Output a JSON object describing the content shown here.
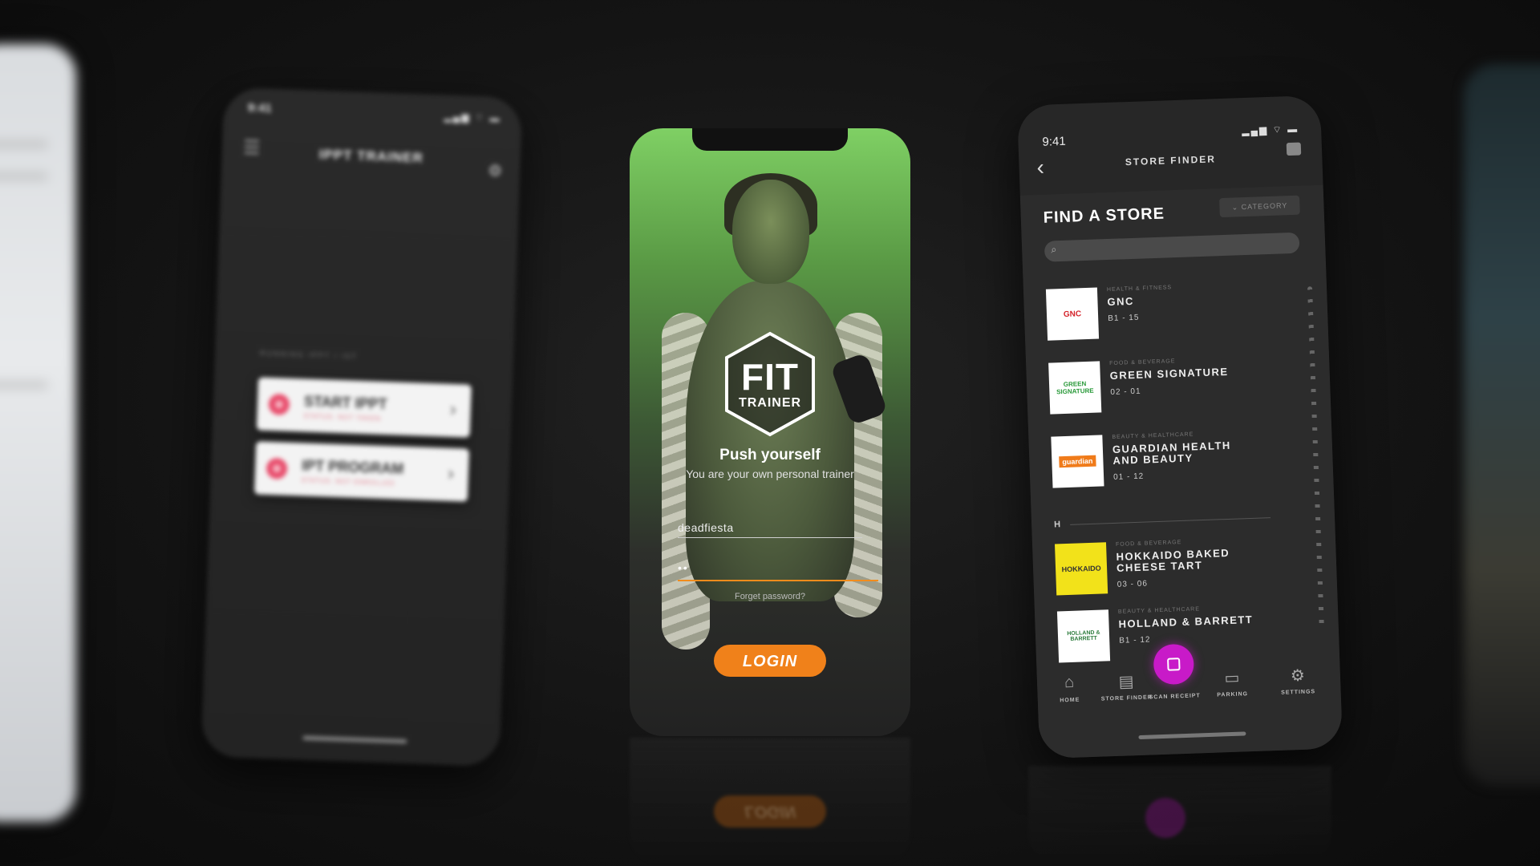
{
  "left_phone": {
    "time": "9:41",
    "status_icons": "▂▄▆ ⌔ ▬",
    "menu_icon": "☰",
    "title": "IPPT TRAINER",
    "settings_icon": "⚙",
    "section_label": "RUNNING IPPT / IST",
    "cards": [
      {
        "title": "START IPPT",
        "subtitle": "STATUS: NOT TAKEN",
        "chevron": "›"
      },
      {
        "title": "IPT PROGRAM",
        "subtitle": "STATUS: NOT ENROLLED",
        "chevron": "›"
      }
    ]
  },
  "center_phone": {
    "logo_line1": "FIT",
    "logo_line2": "TRAINER",
    "headline": "Push yourself",
    "subheadline": "You are your own personal trainer",
    "username_value": "deadfiesta",
    "password_value": "••",
    "forgot_password": "Forget password?",
    "login_button": "LOGIN",
    "accent_color": "#f0811a"
  },
  "right_phone": {
    "time": "9:41",
    "status_icons": "▂▄▆ ⌔ ▬",
    "back_icon": "‹",
    "title": "STORE FINDER",
    "find_heading": "FIND A STORE",
    "category_button": "⌄ CATEGORY",
    "search_icon": "⌕",
    "stores": [
      {
        "logo": "GNC",
        "category": "HEALTH & FITNESS",
        "name": "GNC",
        "unit": "B1 - 15",
        "logo_color": "#d4232a"
      },
      {
        "logo": "GREEN SIGNATURE",
        "category": "FOOD & BEVERAGE",
        "name": "GREEN SIGNATURE",
        "unit": "02 - 01",
        "logo_color": "#2a9a3a"
      },
      {
        "logo": "guardian",
        "category": "BEAUTY & HEALTHCARE",
        "name": "GUARDIAN HEALTH AND BEAUTY",
        "unit": "01 - 12",
        "logo_color": "#f07b1a"
      },
      {
        "logo": "HOKKAIDO",
        "category": "FOOD & BEVERAGE",
        "name": "HOKKAIDO BAKED CHEESE TART",
        "unit": "03 - 06",
        "logo_color": "#f2e21a"
      },
      {
        "logo": "HOLLAND & BARRETT",
        "category": "BEAUTY & HEALTHCARE",
        "name": "HOLLAND & BARRETT",
        "unit": "B1 - 12",
        "logo_color": "#2a7a3a"
      }
    ],
    "section_letter": "H",
    "tabs": [
      {
        "icon": "⌂",
        "label": "HOME"
      },
      {
        "icon": "▤",
        "label": "STORE FINDER"
      },
      {
        "icon": "",
        "label": "SCAN RECEIPT"
      },
      {
        "icon": "▭",
        "label": "PARKING"
      },
      {
        "icon": "⚙",
        "label": "SETTINGS"
      }
    ],
    "active_tab_color": "#c81ac8"
  }
}
